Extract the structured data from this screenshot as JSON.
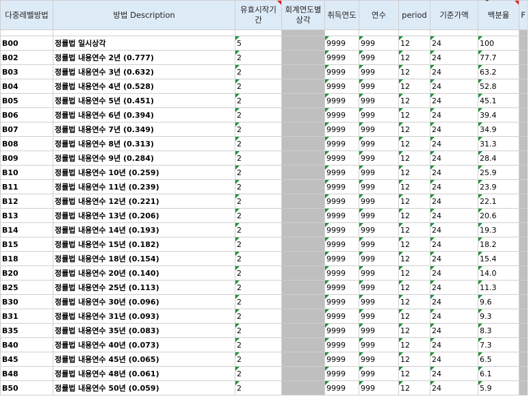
{
  "headers": {
    "code": "다중레벨방법",
    "description": "방법 Description",
    "start_period": "유효시작기간",
    "fiscal_depr": "회계연도별상각",
    "acq_year": "취득연도",
    "years": "연수",
    "period": "period",
    "base_amount": "기준가액",
    "percent": "백분율",
    "next_col": "F"
  },
  "rows": [
    {
      "code": "B00",
      "desc": "정률법 일시상각",
      "start": "5",
      "acq": "9999",
      "years": "999",
      "period": "12",
      "base": "24",
      "pct": "100"
    },
    {
      "code": "B02",
      "desc": "정률법 내용연수 2년 (0.777)",
      "start": "2",
      "acq": "9999",
      "years": "999",
      "period": "12",
      "base": "24",
      "pct": "77.7"
    },
    {
      "code": "B03",
      "desc": "정률법 내용연수 3년 (0.632)",
      "start": "2",
      "acq": "9999",
      "years": "999",
      "period": "12",
      "base": "24",
      "pct": "63.2"
    },
    {
      "code": "B04",
      "desc": "정률법 내용연수 4년 (0.528)",
      "start": "2",
      "acq": "9999",
      "years": "999",
      "period": "12",
      "base": "24",
      "pct": "52.8"
    },
    {
      "code": "B05",
      "desc": "정률법 내용연수 5년 (0.451)",
      "start": "2",
      "acq": "9999",
      "years": "999",
      "period": "12",
      "base": "24",
      "pct": "45.1"
    },
    {
      "code": "B06",
      "desc": "정률법 내용연수 6년 (0.394)",
      "start": "2",
      "acq": "9999",
      "years": "999",
      "period": "12",
      "base": "24",
      "pct": "39.4"
    },
    {
      "code": "B07",
      "desc": "정률법 내용연수 7년 (0.349)",
      "start": "2",
      "acq": "9999",
      "years": "999",
      "period": "12",
      "base": "24",
      "pct": "34.9"
    },
    {
      "code": "B08",
      "desc": "정률법 내용연수 8년 (0.313)",
      "start": "2",
      "acq": "9999",
      "years": "999",
      "period": "12",
      "base": "24",
      "pct": "31.3"
    },
    {
      "code": "B09",
      "desc": "정률법 내용연수 9년 (0.284)",
      "start": "2",
      "acq": "9999",
      "years": "999",
      "period": "12",
      "base": "24",
      "pct": "28.4"
    },
    {
      "code": "B10",
      "desc": "정률법 내용연수 10년 (0.259)",
      "start": "2",
      "acq": "9999",
      "years": "999",
      "period": "12",
      "base": "24",
      "pct": "25.9"
    },
    {
      "code": "B11",
      "desc": "정률법 내용연수 11년 (0.239)",
      "start": "2",
      "acq": "9999",
      "years": "999",
      "period": "12",
      "base": "24",
      "pct": "23.9"
    },
    {
      "code": "B12",
      "desc": "정률법 내용연수 12년 (0.221)",
      "start": "2",
      "acq": "9999",
      "years": "999",
      "period": "12",
      "base": "24",
      "pct": "22.1"
    },
    {
      "code": "B13",
      "desc": "정률법 내용연수 13년 (0.206)",
      "start": "2",
      "acq": "9999",
      "years": "999",
      "period": "12",
      "base": "24",
      "pct": "20.6"
    },
    {
      "code": "B14",
      "desc": "정률법 내용연수 14년 (0.193)",
      "start": "2",
      "acq": "9999",
      "years": "999",
      "period": "12",
      "base": "24",
      "pct": "19.3"
    },
    {
      "code": "B15",
      "desc": "정률법 내용연수 15년 (0.182)",
      "start": "2",
      "acq": "9999",
      "years": "999",
      "period": "12",
      "base": "24",
      "pct": "18.2"
    },
    {
      "code": "B18",
      "desc": "정률법 내용연수 18년 (0.154)",
      "start": "2",
      "acq": "9999",
      "years": "999",
      "period": "12",
      "base": "24",
      "pct": "15.4"
    },
    {
      "code": "B20",
      "desc": "정률법 내용연수 20년 (0.140)",
      "start": "2",
      "acq": "9999",
      "years": "999",
      "period": "12",
      "base": "24",
      "pct": "14.0"
    },
    {
      "code": "B25",
      "desc": "정률법 내용연수 25년 (0.113)",
      "start": "2",
      "acq": "9999",
      "years": "999",
      "period": "12",
      "base": "24",
      "pct": "11.3"
    },
    {
      "code": "B30",
      "desc": "정률법 내용연수 30년 (0.096)",
      "start": "2",
      "acq": "9999",
      "years": "999",
      "period": "12",
      "base": "24",
      "pct": "9.6"
    },
    {
      "code": "B31",
      "desc": "정률법 내용연수 31년 (0.093)",
      "start": "2",
      "acq": "9999",
      "years": "999",
      "period": "12",
      "base": "24",
      "pct": "9.3"
    },
    {
      "code": "B35",
      "desc": "정률법 내용연수 35년 (0.083)",
      "start": "2",
      "acq": "9999",
      "years": "999",
      "period": "12",
      "base": "24",
      "pct": "8.3"
    },
    {
      "code": "B40",
      "desc": "정률법 내용연수 40년 (0.073)",
      "start": "2",
      "acq": "9999",
      "years": "999",
      "period": "12",
      "base": "24",
      "pct": "7.3"
    },
    {
      "code": "B45",
      "desc": "정률법 내용연수 45년 (0.065)",
      "start": "2",
      "acq": "9999",
      "years": "999",
      "period": "12",
      "base": "24",
      "pct": "6.5"
    },
    {
      "code": "B48",
      "desc": "정률법 내용연수 48년 (0.061)",
      "start": "2",
      "acq": "9999",
      "years": "999",
      "period": "12",
      "base": "24",
      "pct": "6.1"
    },
    {
      "code": "B50",
      "desc": "정률법 내용연수 50년 (0.059)",
      "start": "2",
      "acq": "9999",
      "years": "999",
      "period": "12",
      "base": "24",
      "pct": "5.9"
    }
  ],
  "colors": {
    "header_bg": "#ddebf7",
    "grey_column": "#bfbfbf",
    "indicator_green": "#1e8f3a",
    "indicator_red": "#e02020"
  }
}
